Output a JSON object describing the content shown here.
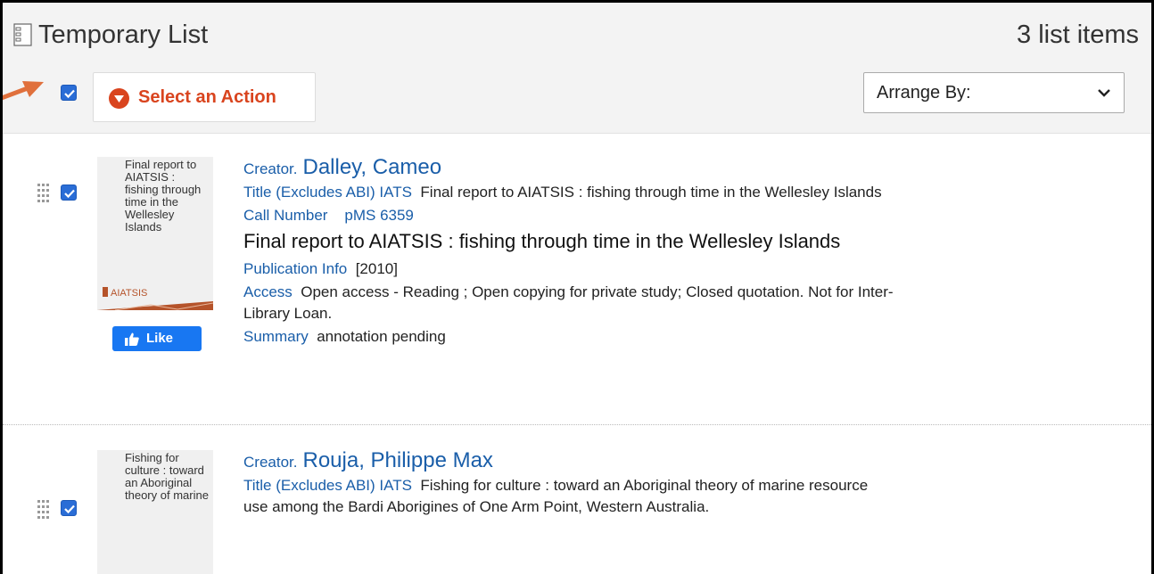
{
  "header": {
    "title": "Temporary List",
    "count_label": "3 list items",
    "select_action_label": "Select an Action",
    "arrange_label": "Arrange By:"
  },
  "items": [
    {
      "thumbnail_text": "Final report to AIATSIS : fishing through time in the Wellesley Islands",
      "thumbnail_brand": "AIATSIS",
      "like_label": "Like",
      "creator_label": "Creator.",
      "creator_name": "Dalley, Cameo",
      "title_label": "Title (Excludes ABI) IATS",
      "title_value": "Final report to AIATSIS : fishing through time in the Wellesley Islands",
      "call_number_label": "Call Number",
      "call_number_value": "pMS 6359",
      "display_title": "Final report to AIATSIS : fishing through time in the Wellesley Islands",
      "publication_label": "Publication Info",
      "publication_value": "[2010]",
      "access_label": "Access",
      "access_value": "Open access - Reading ; Open copying for private study; Closed quotation. Not for Inter-Library Loan.",
      "summary_label": "Summary",
      "summary_value": "annotation pending"
    },
    {
      "thumbnail_text": "Fishing for culture : toward an Aboriginal theory of marine",
      "creator_label": "Creator.",
      "creator_name": "Rouja, Philippe Max",
      "title_label": "Title (Excludes ABI) IATS",
      "title_value": "Fishing for culture : toward an Aboriginal theory of marine resource use among the Bardi Aborigines of One Arm Point, Western Australia."
    }
  ],
  "colors": {
    "accent_link": "#1a5ea9",
    "action_orange": "#d9441e",
    "checkbox_blue": "#2a6dd6",
    "like_blue": "#1877f2",
    "annotation_arrow": "#e0703c"
  }
}
